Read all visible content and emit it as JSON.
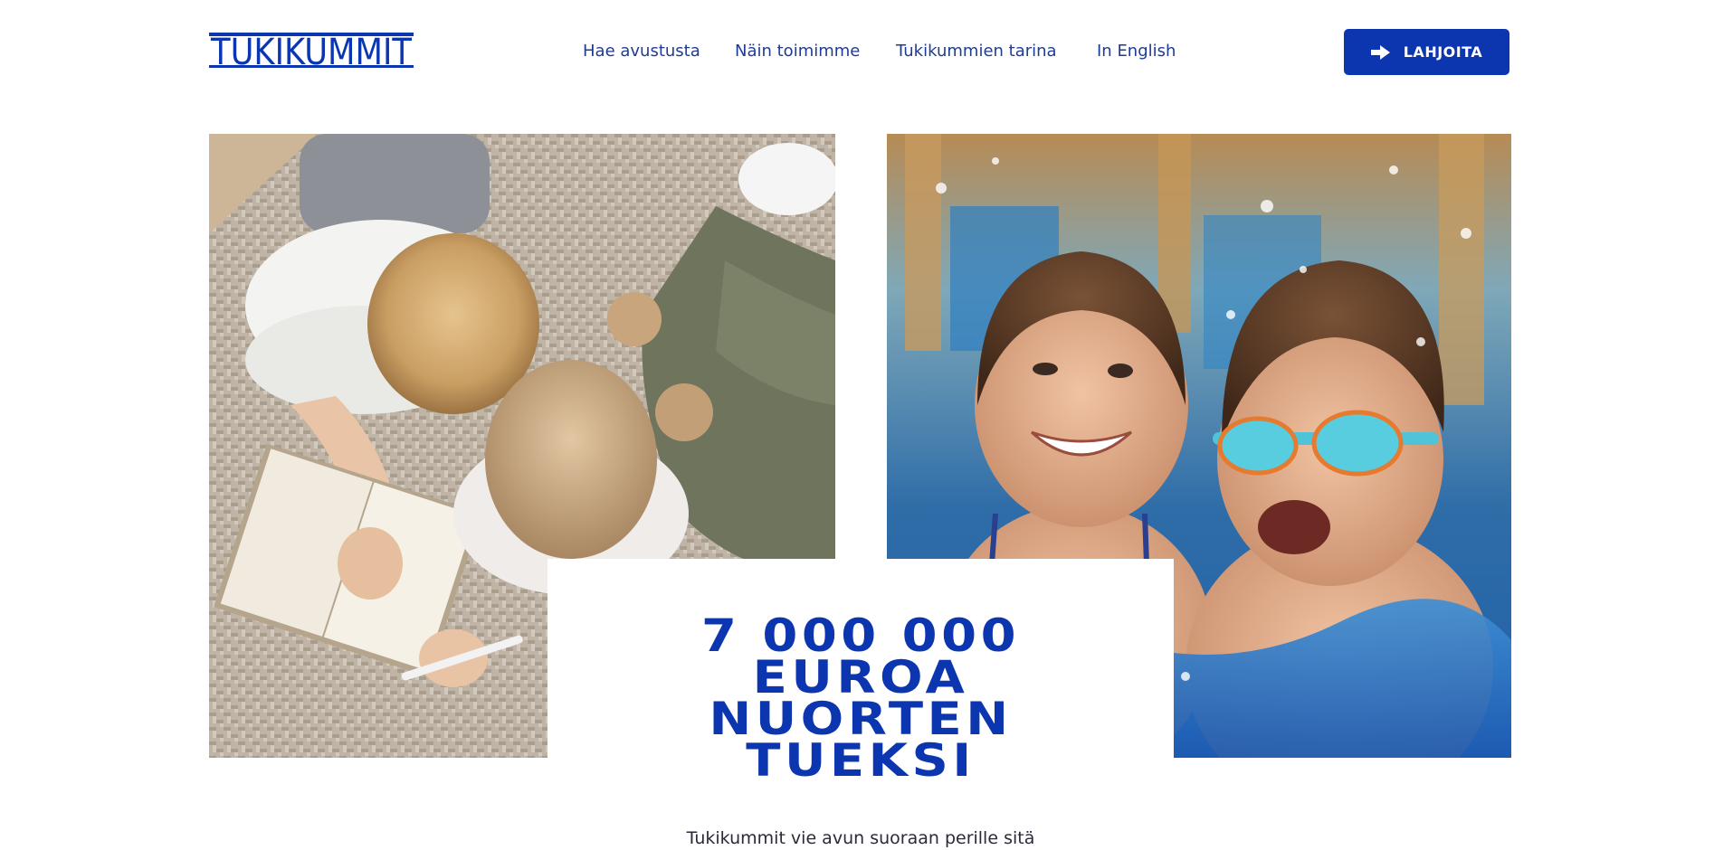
{
  "brand": {
    "logo_text": "TUKIKUMMIT",
    "color": "#0c36b0"
  },
  "nav": {
    "items": [
      {
        "label": "Hae avustusta"
      },
      {
        "label": "Näin toimimme"
      },
      {
        "label": "Tukikummien tarina"
      },
      {
        "label": "In English"
      }
    ],
    "link_color": "#1f3c93"
  },
  "donate": {
    "label": "LAHJOITA",
    "icon": "arrow-right-icon",
    "background": "#0c36b0"
  },
  "hero": {
    "images": [
      {
        "name": "children-drawing-photo"
      },
      {
        "name": "children-swimming-photo"
      }
    ],
    "headline_lines": [
      "7 000 000",
      "EUROA",
      "NUORTEN",
      "TUEKSI"
    ],
    "intro_text": "Tukikummit vie avun suoraan perille sitä"
  }
}
